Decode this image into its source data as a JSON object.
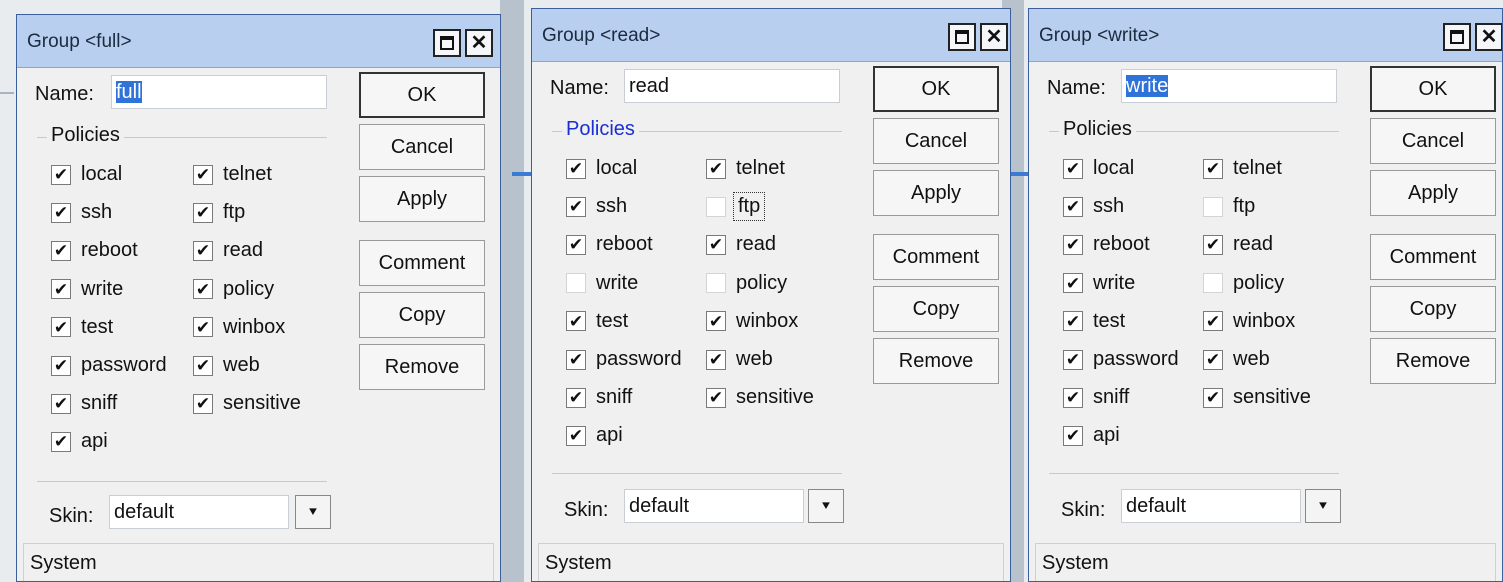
{
  "windows": [
    {
      "title": "Group <full>",
      "name_label": "Name:",
      "name_value": "full",
      "policies_label": "Policies",
      "policies_label_color": "#111111",
      "policies_col1": [
        {
          "label": "local",
          "checked": true
        },
        {
          "label": "ssh",
          "checked": true
        },
        {
          "label": "reboot",
          "checked": true
        },
        {
          "label": "write",
          "checked": true
        },
        {
          "label": "test",
          "checked": true
        },
        {
          "label": "password",
          "checked": true
        },
        {
          "label": "sniff",
          "checked": true
        },
        {
          "label": "api",
          "checked": true
        }
      ],
      "policies_col2": [
        {
          "label": "telnet",
          "checked": true
        },
        {
          "label": "ftp",
          "checked": true
        },
        {
          "label": "read",
          "checked": true
        },
        {
          "label": "policy",
          "checked": true
        },
        {
          "label": "winbox",
          "checked": true
        },
        {
          "label": "web",
          "checked": true
        },
        {
          "label": "sensitive",
          "checked": true
        }
      ],
      "skin_label": "Skin:",
      "skin_value": "default",
      "buttons": {
        "ok": "OK",
        "cancel": "Cancel",
        "apply": "Apply",
        "comment": "Comment",
        "copy": "Copy",
        "remove": "Remove"
      },
      "status": "System"
    },
    {
      "title": "Group <read>",
      "name_label": "Name:",
      "name_value": "read",
      "policies_label": "Policies",
      "policies_label_color": "#1a2fd0",
      "policies_col1": [
        {
          "label": "local",
          "checked": true
        },
        {
          "label": "ssh",
          "checked": true
        },
        {
          "label": "reboot",
          "checked": true
        },
        {
          "label": "write",
          "checked": false
        },
        {
          "label": "test",
          "checked": true
        },
        {
          "label": "password",
          "checked": true
        },
        {
          "label": "sniff",
          "checked": true
        },
        {
          "label": "api",
          "checked": true
        }
      ],
      "policies_col2": [
        {
          "label": "telnet",
          "checked": true
        },
        {
          "label": "ftp",
          "checked": false
        },
        {
          "label": "read",
          "checked": true
        },
        {
          "label": "policy",
          "checked": false
        },
        {
          "label": "winbox",
          "checked": true
        },
        {
          "label": "web",
          "checked": true
        },
        {
          "label": "sensitive",
          "checked": true
        }
      ],
      "skin_label": "Skin:",
      "skin_value": "default",
      "buttons": {
        "ok": "OK",
        "cancel": "Cancel",
        "apply": "Apply",
        "comment": "Comment",
        "copy": "Copy",
        "remove": "Remove"
      },
      "status": "System"
    },
    {
      "title": "Group <write>",
      "name_label": "Name:",
      "name_value": "write",
      "policies_label": "Policies",
      "policies_label_color": "#111111",
      "policies_col1": [
        {
          "label": "local",
          "checked": true
        },
        {
          "label": "ssh",
          "checked": true
        },
        {
          "label": "reboot",
          "checked": true
        },
        {
          "label": "write",
          "checked": true
        },
        {
          "label": "test",
          "checked": true
        },
        {
          "label": "password",
          "checked": true
        },
        {
          "label": "sniff",
          "checked": true
        },
        {
          "label": "api",
          "checked": true
        }
      ],
      "policies_col2": [
        {
          "label": "telnet",
          "checked": true
        },
        {
          "label": "ftp",
          "checked": false
        },
        {
          "label": "read",
          "checked": true
        },
        {
          "label": "policy",
          "checked": false
        },
        {
          "label": "winbox",
          "checked": true
        },
        {
          "label": "web",
          "checked": true
        },
        {
          "label": "sensitive",
          "checked": true
        }
      ],
      "skin_label": "Skin:",
      "skin_value": "default",
      "buttons": {
        "ok": "OK",
        "cancel": "Cancel",
        "apply": "Apply",
        "comment": "Comment",
        "copy": "Copy",
        "remove": "Remove"
      },
      "status": "System"
    }
  ]
}
